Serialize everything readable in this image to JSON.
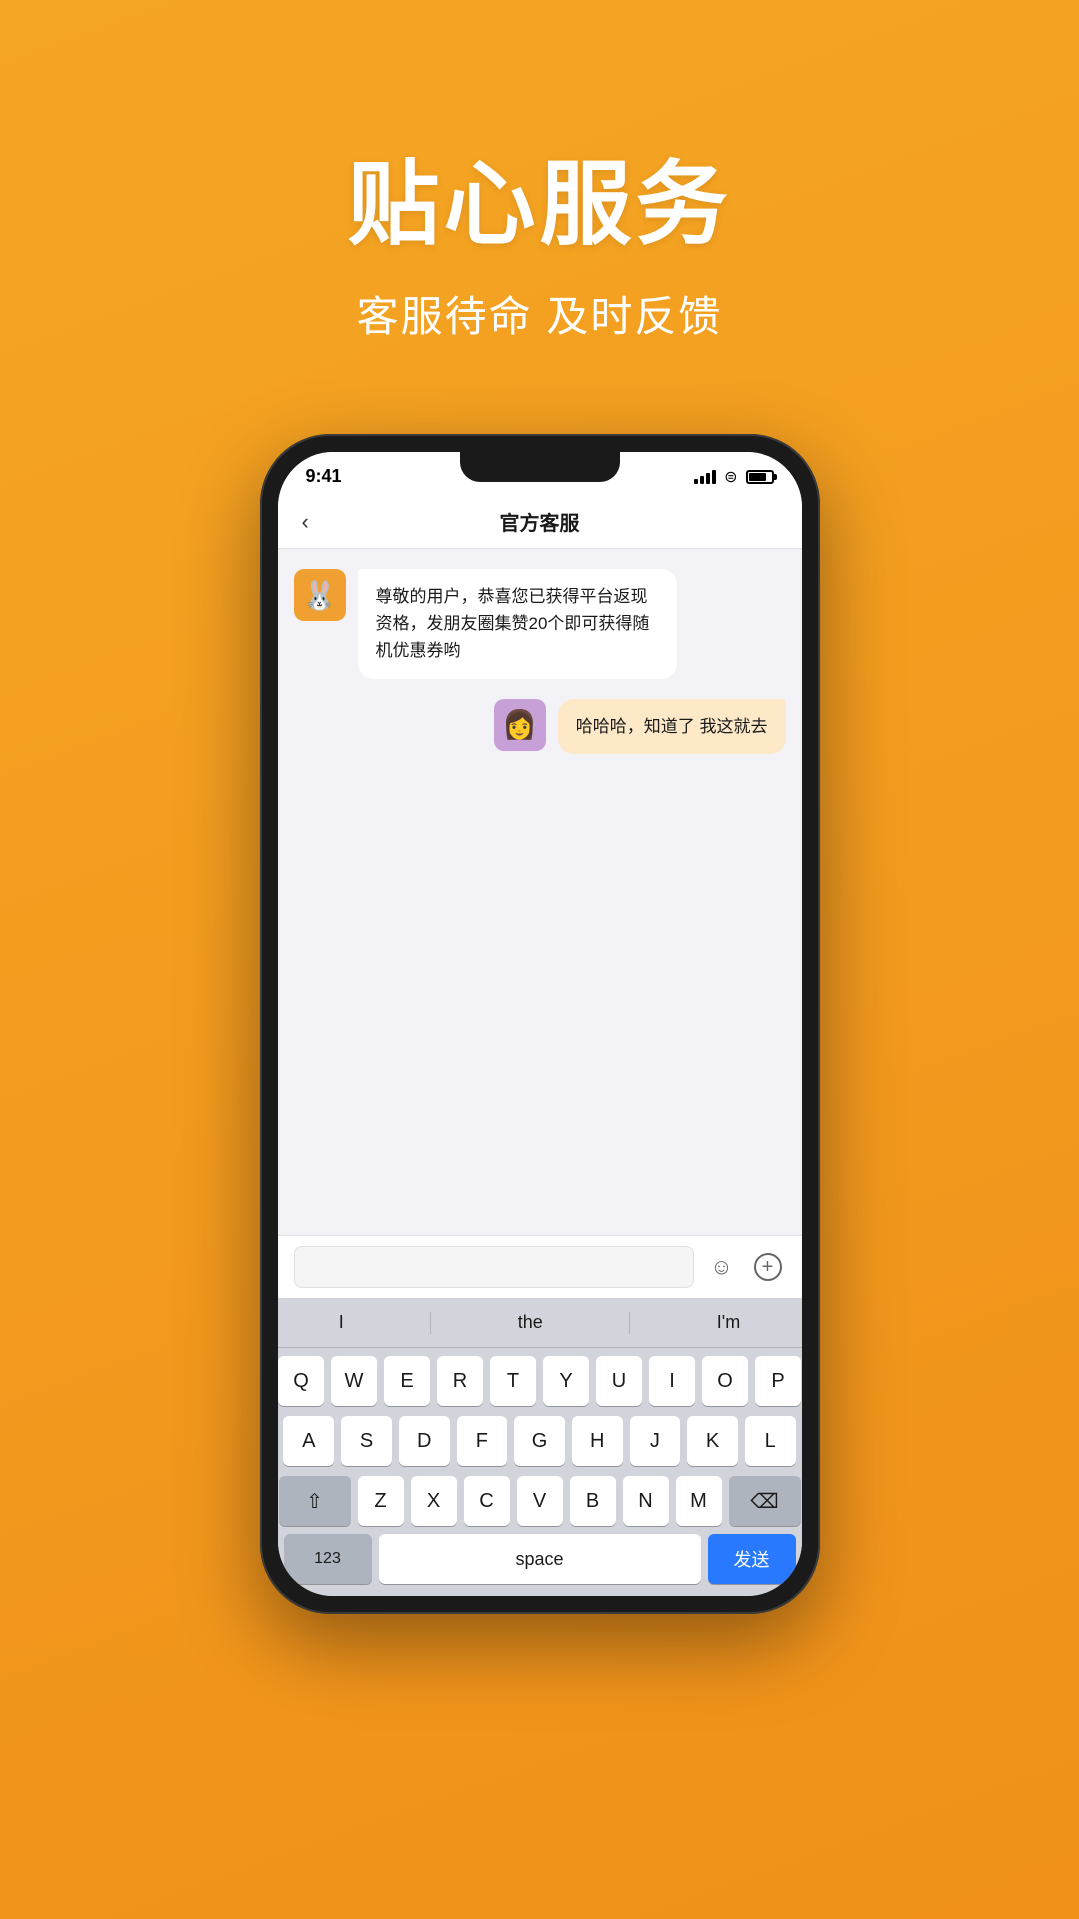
{
  "hero": {
    "title": "贴心服务",
    "subtitle": "客服待命 及时反馈"
  },
  "phone": {
    "status_bar": {
      "time": "9:41",
      "signal": "signal",
      "wifi": "wifi",
      "battery": "battery"
    },
    "nav": {
      "back_label": "‹",
      "title": "官方客服"
    },
    "chat": {
      "messages": [
        {
          "id": "msg1",
          "type": "incoming",
          "text": "尊敬的用户，恭喜您已获得平台返现资格，发朋友圈集赞20个即可获得随机优惠券哟",
          "avatar": "🐰"
        },
        {
          "id": "msg2",
          "type": "outgoing",
          "text": "哈哈哈，知道了 我这就去",
          "avatar": "👩"
        }
      ]
    },
    "input_bar": {
      "placeholder": "",
      "emoji_icon": "☺",
      "plus_icon": "+"
    },
    "keyboard": {
      "suggestions": [
        "I",
        "the",
        "I'm"
      ],
      "rows": [
        [
          "Q",
          "W",
          "E",
          "R",
          "T",
          "Y",
          "U",
          "I",
          "O",
          "P"
        ],
        [
          "A",
          "S",
          "D",
          "F",
          "G",
          "H",
          "J",
          "K",
          "L"
        ],
        [
          "⇧",
          "Z",
          "X",
          "C",
          "V",
          "B",
          "N",
          "M",
          "⌫"
        ]
      ],
      "bottom": {
        "num_label": "123",
        "space_label": "space",
        "send_label": "发送"
      }
    }
  }
}
